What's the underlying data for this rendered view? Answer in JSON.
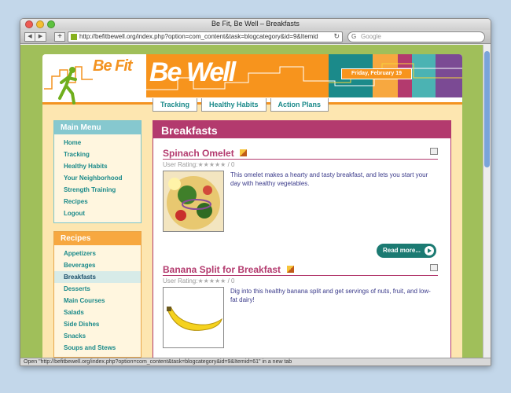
{
  "window": {
    "title": "Be Fit, Be Well – Breakfasts"
  },
  "browser": {
    "url": "http://befitbewell.org/index.php?option=com_content&task=blogcategory&id=9&Itemid",
    "search_placeholder": "Google",
    "back_glyph": "◀",
    "forward_glyph": "▶",
    "plus_glyph": "+",
    "reload_glyph": "↻",
    "search_glyph": "G",
    "status": "Open \"http://befitbewell.org/index.php?option=com_content&task=blogcategory&id=9&Itemid=61\" in a new tab"
  },
  "site": {
    "logo_left": "Be Fit",
    "logo_right": "Be Well",
    "date": "Friday, February 19",
    "tabs": [
      "Tracking",
      "Healthy Habits",
      "Action Plans"
    ],
    "colors": {
      "orange": "#f7941d",
      "teal": "#1b8a8a",
      "magenta": "#b33a6e",
      "purple": "#7b4a94",
      "aqua": "#4bb3b3"
    }
  },
  "sidebar": {
    "main_menu": {
      "title": "Main Menu",
      "items": [
        "Home",
        "Tracking",
        "Healthy Habits",
        "Your Neighborhood",
        "Strength Training",
        "Recipes",
        "Logout"
      ]
    },
    "recipes": {
      "title": "Recipes",
      "items": [
        "Appetizers",
        "Beverages",
        "Breakfasts",
        "Desserts",
        "Main Courses",
        "Salads",
        "Side Dishes",
        "Snacks",
        "Soups and Stews"
      ],
      "active": "Breakfasts"
    }
  },
  "content": {
    "heading": "Breakfasts",
    "articles": [
      {
        "title": "Spinach Omelet",
        "rating_label": "User Rating:",
        "rating_count": "/ 0",
        "summary": "This omelet makes a hearty and tasty breakfast, and lets you start your day with healthy vegetables.",
        "read_more": "Read more..."
      },
      {
        "title": "Banana Split for Breakfast",
        "rating_label": "User Rating:",
        "rating_count": "/ 0",
        "summary": "Dig into this healthy banana split and get servings of nuts, fruit, and low-fat dairy!"
      }
    ]
  }
}
